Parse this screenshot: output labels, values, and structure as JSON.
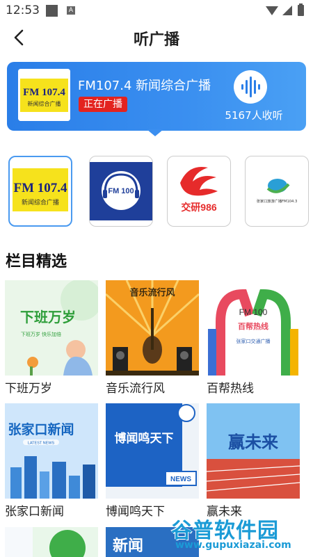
{
  "status_bar": {
    "time": "12:53",
    "badge": "A"
  },
  "header": {
    "title": "听广播"
  },
  "now_playing": {
    "logo_title": "FM 107.4",
    "logo_subtitle": "新闻综合广播",
    "station_name": "FM107.4 新闻综合广播",
    "badge": "正在广播",
    "listeners": "5167人收听"
  },
  "stations": [
    {
      "title": "FM 107.4",
      "subtitle": "新闻综合广播",
      "selected": true
    },
    {
      "title": "FM 100",
      "subtitle": ""
    },
    {
      "title": "交研986",
      "subtitle": ""
    },
    {
      "title": "张家口旅游广播FM104.3",
      "subtitle": ""
    }
  ],
  "section": {
    "title": "栏目精选"
  },
  "programs": [
    {
      "label": "下班万岁",
      "art_text": "下班万岁",
      "art_sub": "下班万岁  快乐加倍"
    },
    {
      "label": "音乐流行风",
      "art_text": "音乐流行风"
    },
    {
      "label": "百帮热线",
      "art_text": "FM 100",
      "art_sub": "百帮热线",
      "art_sub2": "张家口交通广播"
    },
    {
      "label": "张家口新闻",
      "art_text": "张家口新闻",
      "art_sub": "LATEST NEWS"
    },
    {
      "label": "博闻鸣天下",
      "art_text": "博闻鸣天下",
      "art_sub": "NEWS"
    },
    {
      "label": "赢未来",
      "art_text": "赢未来"
    },
    {
      "label": "",
      "art_text": ""
    },
    {
      "label": "",
      "art_text": "新闻"
    }
  ],
  "watermark": {
    "big": "谷普软件园",
    "small": "www.gupuxiazai.com"
  },
  "colors": {
    "accent": "#2a7ee8",
    "badge_red": "#e3231f"
  }
}
